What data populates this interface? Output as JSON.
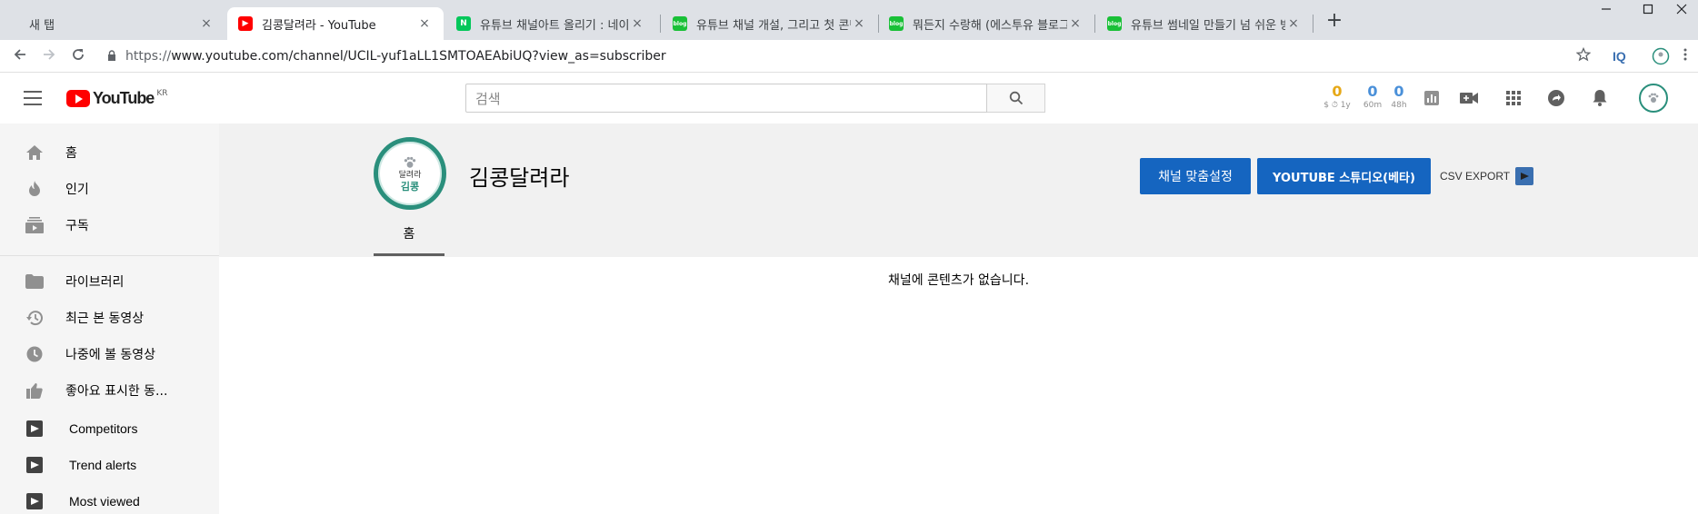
{
  "browser": {
    "tabs": [
      {
        "title": "새 탭"
      },
      {
        "title": "김콩달려라 - YouTube"
      },
      {
        "title": "유튜브 채널아트 올리기 : 네이버",
        "favicon_text": "N"
      },
      {
        "title": "유튜브 채널 개설, 그리고 첫 콘텐",
        "favicon_text": "blog"
      },
      {
        "title": "뭐든지 수랑해 (에스투유 블로그",
        "favicon_text": "blog"
      },
      {
        "title": "유튜브 썸네일 만들기 넘 쉬운 방",
        "favicon_text": "blog"
      }
    ],
    "close_glyph": "×",
    "newtab_glyph": "+",
    "url_scheme": "https://",
    "url_rest": "www.youtube.com/channel/UCIL-yuf1aLL1SMTOAEAbiUQ?view_as=subscriber",
    "ext_label": "IQ"
  },
  "masthead": {
    "logo_text": "YouTube",
    "country": "KR",
    "search_placeholder": "검색",
    "stats": [
      {
        "value": "0",
        "sub": "$ ⏱ 1y",
        "color": "#e6a817"
      },
      {
        "value": "0",
        "sub": "60m",
        "color": "#4a90d9"
      },
      {
        "value": "0",
        "sub": "48h",
        "color": "#4a90d9"
      }
    ]
  },
  "guide": {
    "items": [
      {
        "label": "홈",
        "icon": "home-icon"
      },
      {
        "label": "인기",
        "icon": "fire-icon"
      },
      {
        "label": "구독",
        "icon": "subscriptions-icon"
      },
      {
        "label": "라이브러리",
        "icon": "folder-icon"
      },
      {
        "label": "최근 본 동영상",
        "icon": "history-icon"
      },
      {
        "label": "나중에 볼 동영상",
        "icon": "clock-icon"
      },
      {
        "label": "좋아요 표시한 동...",
        "icon": "thumb-up-icon"
      },
      {
        "label": "Competitors",
        "icon": "vidiq-icon"
      },
      {
        "label": "Trend alerts",
        "icon": "vidiq-icon"
      },
      {
        "label": "Most viewed",
        "icon": "vidiq-icon"
      }
    ]
  },
  "channel": {
    "avatar_line1": "달려라",
    "avatar_line2": "김콩",
    "name": "김콩달려라",
    "customize_button": "채널 맞춤설정",
    "studio_button": "YOUTUBE 스튜디오(베타)",
    "csv_export": "CSV EXPORT",
    "tab_home": "홈",
    "empty_message": "채널에 콘텐츠가 없습니다."
  },
  "colors": {
    "brand_red": "#ff0000",
    "primary_blue": "#1565c0",
    "avatar_teal": "#2a8f7c"
  }
}
